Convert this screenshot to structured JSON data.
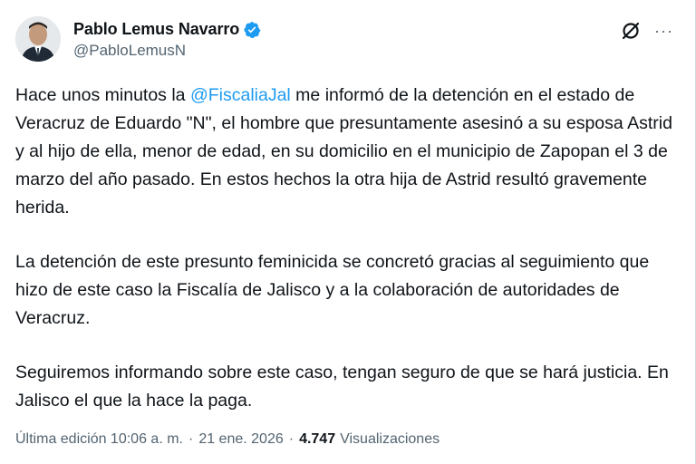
{
  "author": {
    "name": "Pablo Lemus Navarro",
    "handle": "@PabloLemusN",
    "verified": true,
    "verified_color": "#1d9bf0"
  },
  "icons": {
    "grok": "grok-icon",
    "more": "more-icon"
  },
  "tweet": {
    "p1_before": "Hace unos minutos la ",
    "p1_mention": "@FiscaliaJal",
    "p1_after": " me informó de la detención en el estado de Veracruz de Eduardo \"N\",  el hombre que presuntamente asesinó a su esposa Astrid y al hijo de ella, menor de edad, en su domicilio en el municipio de Zapopan el 3 de marzo del año pasado. En estos hechos la otra hija de Astrid resultó gravemente herida.",
    "p2": "La detención de este presunto feminicida se concretó gracias al seguimiento que hizo de este caso la Fiscalía de Jalisco y a la colaboración de autoridades de Veracruz.",
    "p3": "Seguiremos informando sobre este caso, tengan seguro de que se hará justicia. En Jalisco el que la hace la paga."
  },
  "meta": {
    "edited": "Última edición 10:06 a. m.",
    "date": "21 ene. 2026",
    "separator": "·",
    "views_count": "4.747",
    "views_label": "Visualizaciones"
  }
}
